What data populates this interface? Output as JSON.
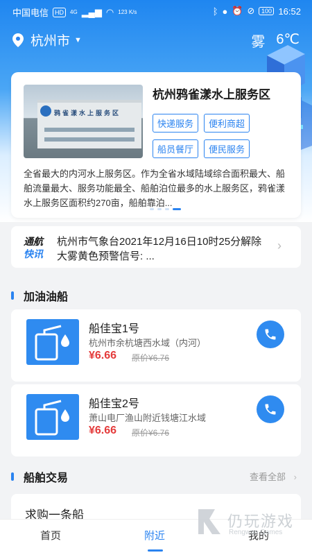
{
  "status_bar": {
    "carrier": "中国电信",
    "hd_badge": "HD",
    "network": "4G",
    "speed": "123 K/s",
    "battery": "100",
    "time": "16:52"
  },
  "header": {
    "city": "杭州市",
    "weather": "雾",
    "temperature": "6℃"
  },
  "banner": {
    "photo_sign": "鸦雀漾水上服务区",
    "title": "杭州鸦雀漾水上服务区",
    "tags": [
      "快递服务",
      "便利商超",
      "船员餐厅",
      "便民服务"
    ],
    "description": "全省最大的内河水上服务区。作为全省水域陆域综合面积最大、船舶流量最大、服务功能最全、船舶泊位最多的水上服务区，鸦雀漾水上服务区面积约270亩，船舶靠泊...",
    "page_count": 4,
    "active_page": 4
  },
  "notice": {
    "badge_line1": "通航",
    "badge_line2": "快讯",
    "text": "杭州市气象台2021年12月16日10时25分解除大雾黄色预警信号: ..."
  },
  "fuel_section": {
    "title": "加油油船",
    "items": [
      {
        "name": "船佳宝1号",
        "address": "杭州市余杭塘西水域（内河）",
        "price": "¥6.66",
        "original_price": "原价¥6.76"
      },
      {
        "name": "船佳宝2号",
        "address": "萧山电厂渔山附近钱塘江水域",
        "price": "¥6.66",
        "original_price": "原价¥6.76"
      }
    ]
  },
  "trade_section": {
    "title": "船舶交易",
    "see_all": "查看全部",
    "first_item": "求购一条船"
  },
  "tabbar": {
    "tabs": [
      "首页",
      "附近",
      "我的"
    ],
    "active": "附近"
  },
  "watermark": {
    "text": "仍玩游戏",
    "subtext": "Rengwan Games"
  },
  "colors": {
    "accent": "#2a83f0",
    "price": "#e43b3b"
  }
}
